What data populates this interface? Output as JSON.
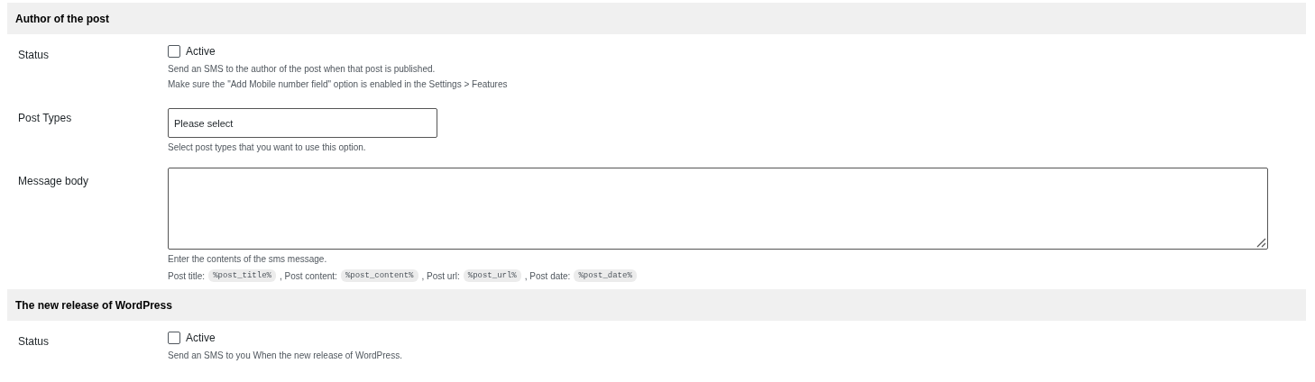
{
  "sections": [
    {
      "title": "Author of the post",
      "rows": [
        {
          "kind": "checkbox",
          "label": "Status",
          "option": "Active",
          "checked": false,
          "hints": [
            "Send an SMS to the author of the post when that post is published.",
            "Make sure the \"Add Mobile number field\" option is enabled in the Settings > Features"
          ]
        },
        {
          "kind": "select",
          "label": "Post Types",
          "value": "Please select",
          "hints": [
            "Select post types that you want to use this option."
          ]
        },
        {
          "kind": "textarea",
          "label": "Message body",
          "hints": [
            "Enter the contents of the sms message."
          ],
          "variables": [
            {
              "label": "Post title:",
              "code": "%post_title%"
            },
            {
              "label": ", Post content:",
              "code": "%post_content%"
            },
            {
              "label": ", Post url:",
              "code": "%post_url%"
            },
            {
              "label": ", Post date:",
              "code": "%post_date%"
            }
          ]
        }
      ]
    },
    {
      "title": "The new release of WordPress",
      "rows": [
        {
          "kind": "checkbox",
          "label": "Status",
          "option": "Active",
          "checked": false,
          "hints": [
            "Send an SMS to you When the new release of WordPress."
          ]
        }
      ]
    }
  ]
}
